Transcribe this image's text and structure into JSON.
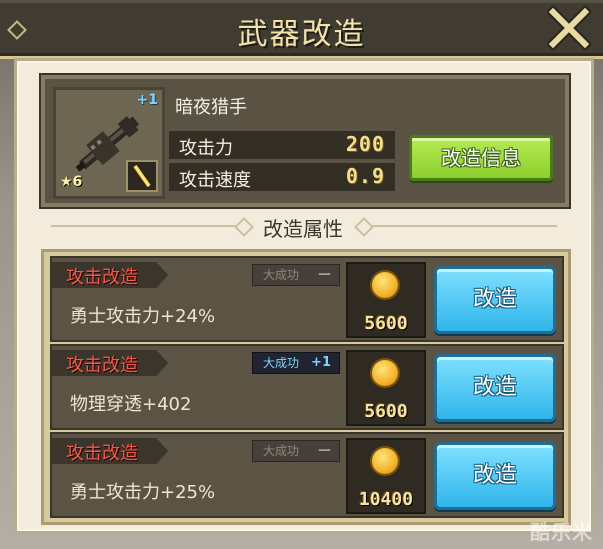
{
  "window": {
    "title": "武器改造",
    "close_icon": "close-x-icon"
  },
  "weapon": {
    "plus_level": "+1",
    "stars": "★6",
    "name": "暗夜猎手",
    "stats": [
      {
        "label": "攻击力",
        "value": "200"
      },
      {
        "label": "攻击速度",
        "value": "0.9"
      }
    ],
    "info_button": "改造信息"
  },
  "section": {
    "title": "改造属性"
  },
  "upgrades": [
    {
      "tag": "攻击改造",
      "effect": "勇士攻击力+24%",
      "crit_label": "大成功",
      "crit_mark": "—",
      "crit_active": false,
      "cost": "5600",
      "button": "改造"
    },
    {
      "tag": "攻击改造",
      "effect": "物理穿透+402",
      "crit_label": "大成功",
      "crit_mark": "+1",
      "crit_active": true,
      "cost": "5600",
      "button": "改造"
    },
    {
      "tag": "攻击改造",
      "effect": "勇士攻击力+25%",
      "crit_label": "大成功",
      "crit_mark": "—",
      "crit_active": false,
      "cost": "10400",
      "button": "改造"
    }
  ],
  "watermark": "酷乐米",
  "colors": {
    "title_bar": "#403c31",
    "panel": "#f3ecdc",
    "tag_text": "#f25a4a",
    "info_button": "#8ccf2d",
    "upgrade_button": "#2fb6ea",
    "cost_text": "#f6e2a4"
  }
}
